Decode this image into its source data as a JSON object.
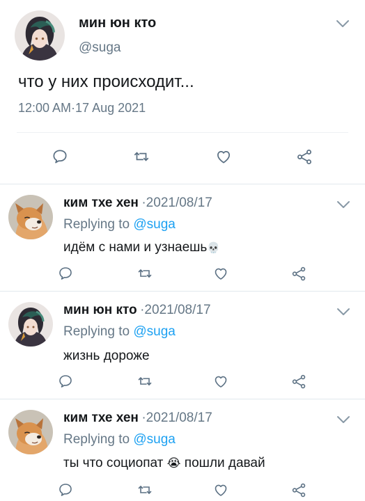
{
  "main_tweet": {
    "author_name": "мин юн кто",
    "handle": "@suga",
    "text": "что у них происходит...",
    "timestamp": "12:00 AM·17 Aug 2021",
    "avatar_icon": "anime-character-avatar"
  },
  "replies_label": "Replying to",
  "reply_handle": "@suga",
  "replies": [
    {
      "author_name": "ким тхе хен",
      "date": "·2021/08/17",
      "text": "идём с нами и узнаешь",
      "emoji": "💀",
      "avatar_icon": "dog-avatar"
    },
    {
      "author_name": "мин юн кто",
      "date": "·2021/08/17",
      "text": "жизнь дороже",
      "emoji": "",
      "avatar_icon": "anime-character-avatar"
    },
    {
      "author_name": "ким тхе хен",
      "date": "·2021/08/17",
      "text": "ты что социопат",
      "emoji": "😭",
      "text_after": "пошли давай",
      "avatar_icon": "dog-avatar"
    }
  ],
  "colors": {
    "accent": "#1da1f2",
    "muted": "#657786",
    "icon": "#5b7083",
    "text": "#14171a"
  }
}
